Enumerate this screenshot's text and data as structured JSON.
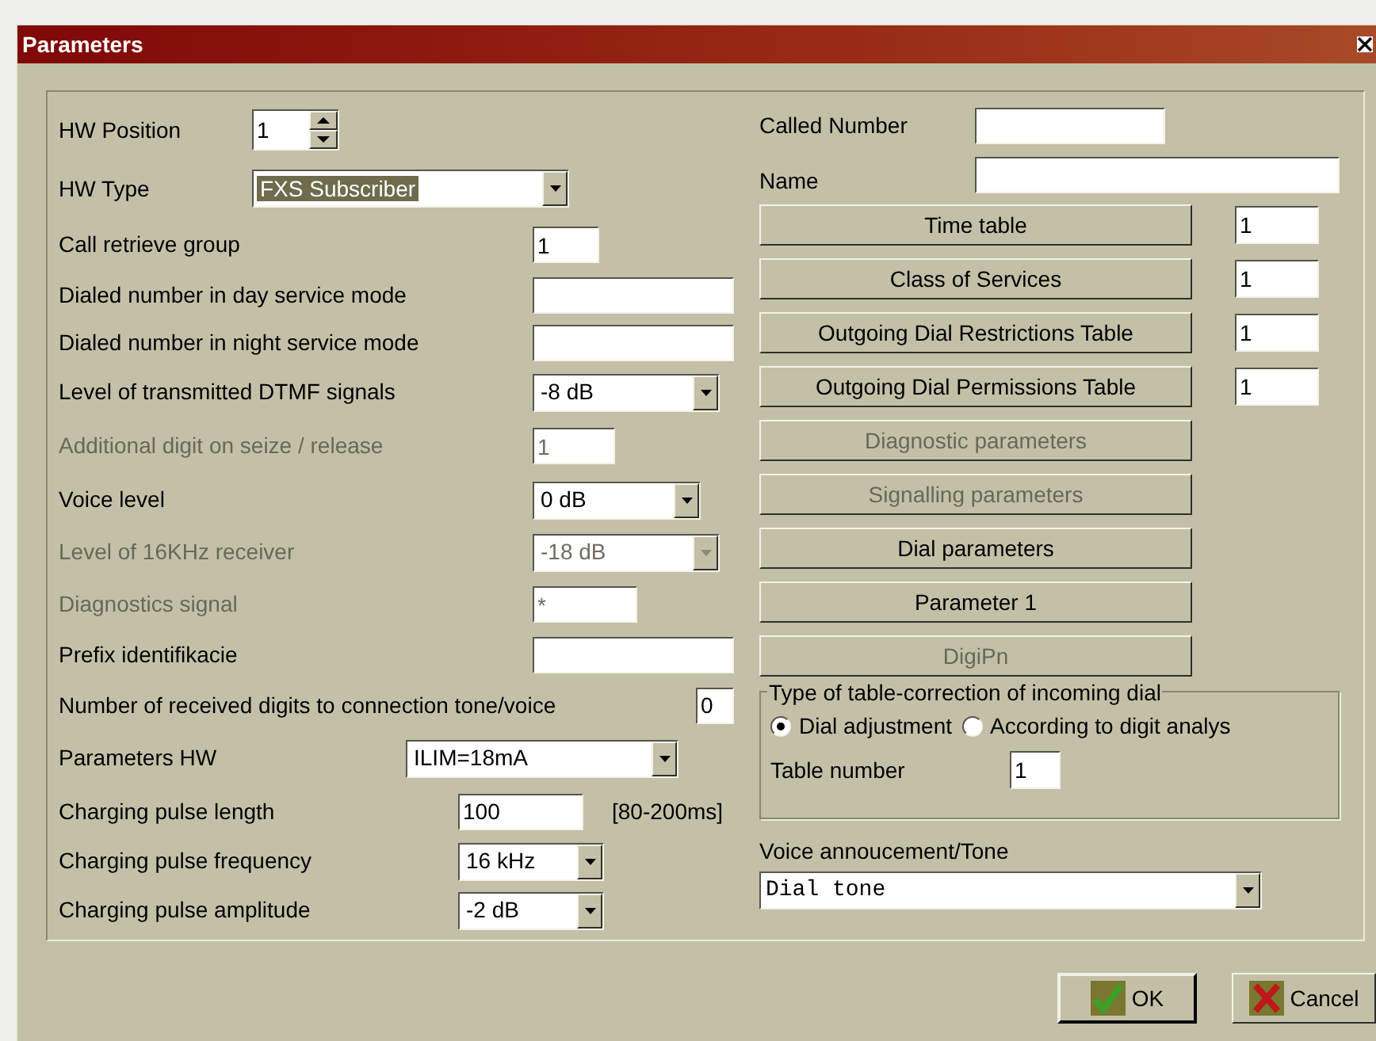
{
  "window": {
    "title": "Parameters"
  },
  "left_rows": [
    {
      "kind": "spin",
      "label": "HW Position",
      "value": "1",
      "disabled": false
    },
    {
      "kind": "combo",
      "label": "HW Type",
      "value": "FXS Subscriber",
      "disabled": false,
      "text_selected": true
    },
    {
      "kind": "text",
      "label": "Call retrieve group",
      "value": "1",
      "disabled": false
    },
    {
      "kind": "text",
      "label": "Dialed number in day service mode",
      "disabled": false
    },
    {
      "kind": "text",
      "label": "Dialed number in night service mode",
      "disabled": false
    },
    {
      "kind": "combo",
      "label": "Level of transmitted DTMF signals",
      "value": "-8 dB",
      "disabled": false
    },
    {
      "kind": "text",
      "label": "Additional digit on seize / release",
      "value": "1",
      "disabled": true
    },
    {
      "kind": "combo",
      "label": "Voice level",
      "value": "0 dB",
      "disabled": false
    },
    {
      "kind": "combo",
      "label": "Level of 16KHz receiver",
      "value": "-18 dB",
      "disabled": true
    },
    {
      "kind": "text",
      "label": "Diagnostics signal",
      "value": "*",
      "disabled": true
    },
    {
      "kind": "text",
      "label": "Prefix identifikacie",
      "disabled": false
    },
    {
      "kind": "text",
      "label": "Number of received digits to connection tone/voice",
      "value": "0",
      "disabled": false
    },
    {
      "kind": "combo",
      "label": "Parameters HW",
      "value": "ILIM=18mA",
      "disabled": false
    },
    {
      "kind": "text",
      "label": "Charging pulse length",
      "value": "100",
      "suffix": "[80-200ms]",
      "disabled": false
    },
    {
      "kind": "combo",
      "label": "Charging pulse frequency",
      "value": "16 kHz",
      "disabled": false
    },
    {
      "kind": "combo",
      "label": "Charging pulse amplitude",
      "value": "-2 dB",
      "disabled": false
    }
  ],
  "called_number": {
    "label": "Called Number"
  },
  "name": {
    "label": "Name"
  },
  "table_buttons": [
    {
      "label": "Time table",
      "disabled": false,
      "value": "1"
    },
    {
      "label": "Class of Services",
      "disabled": false,
      "value": "1"
    },
    {
      "label": "Outgoing Dial Restrictions Table",
      "disabled": false,
      "value": "1"
    },
    {
      "label": "Outgoing Dial Permissions Table",
      "disabled": false,
      "value": "1"
    },
    {
      "label": "Diagnostic parameters",
      "disabled": true
    },
    {
      "label": "Signalling parameters",
      "disabled": true
    },
    {
      "label": "Dial parameters",
      "disabled": false
    },
    {
      "label": "Parameter 1",
      "disabled": false
    },
    {
      "label": "DigiPn",
      "disabled": true
    }
  ],
  "correction_group": {
    "title": "Type of table-correction of incoming dial",
    "options": [
      {
        "label": "Dial adjustment",
        "selected": true
      },
      {
        "label": "According to digit analys",
        "selected": false
      }
    ],
    "table_number": {
      "label": "Table number",
      "value": "1"
    }
  },
  "voice": {
    "label": "Voice annoucement/Tone",
    "value": "Dial tone"
  },
  "footer_buttons": [
    {
      "kind": "ok",
      "label": "OK"
    },
    {
      "kind": "cancel",
      "label": "Cancel"
    }
  ]
}
